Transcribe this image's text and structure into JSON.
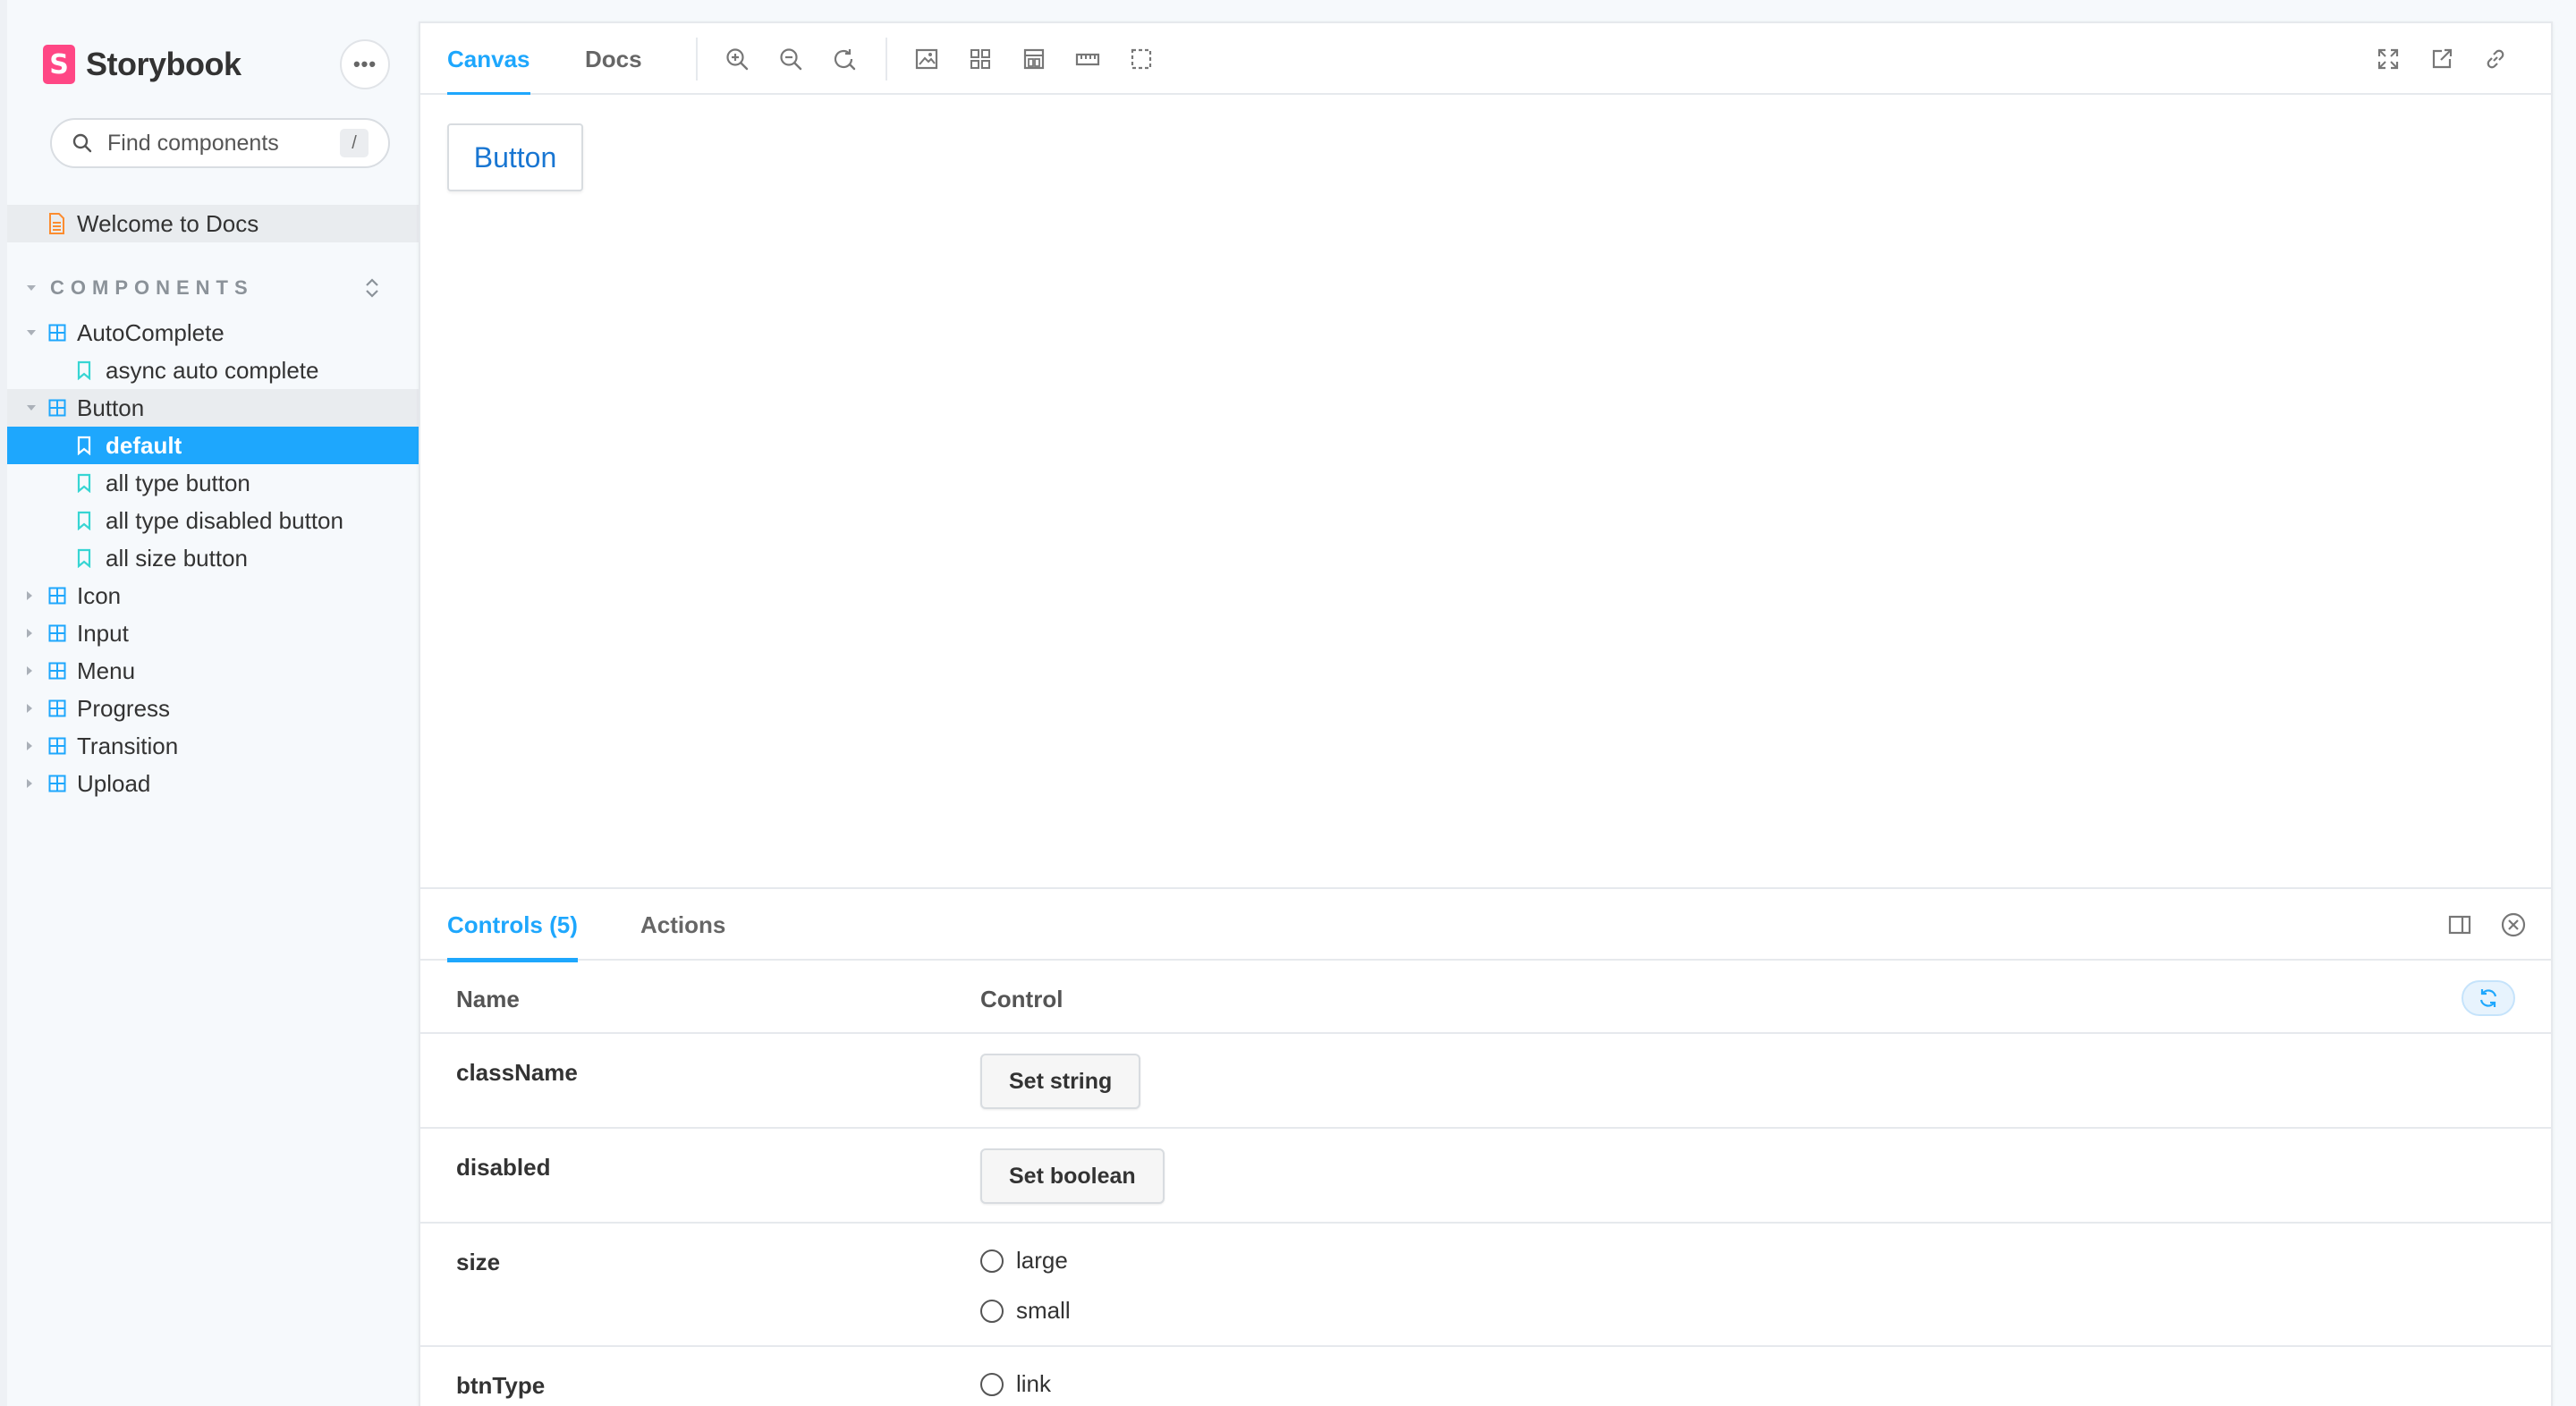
{
  "brand": {
    "logo_letter": "S",
    "name": "Storybook"
  },
  "menu": {
    "label": "•••"
  },
  "search": {
    "placeholder": "Find components",
    "shortcut": "/"
  },
  "sidebar": {
    "welcome": "Welcome to Docs",
    "section_title": "COMPONENTS",
    "items": [
      {
        "label": "AutoComplete"
      },
      {
        "label": "async auto complete"
      },
      {
        "label": "Button"
      },
      {
        "label": "default"
      },
      {
        "label": "all type button"
      },
      {
        "label": "all type disabled button"
      },
      {
        "label": "all size button"
      },
      {
        "label": "Icon"
      },
      {
        "label": "Input"
      },
      {
        "label": "Menu"
      },
      {
        "label": "Progress"
      },
      {
        "label": "Transition"
      },
      {
        "label": "Upload"
      }
    ]
  },
  "toolbar": {
    "tab_canvas": "Canvas",
    "tab_docs": "Docs"
  },
  "canvas": {
    "button_label": "Button"
  },
  "addons": {
    "tab_controls": "Controls (5)",
    "tab_actions": "Actions"
  },
  "controls": {
    "col_name": "Name",
    "col_control": "Control",
    "rows": [
      {
        "name": "className",
        "control": "Set string"
      },
      {
        "name": "disabled",
        "control": "Set boolean"
      },
      {
        "name": "size",
        "options": [
          "large",
          "small"
        ]
      },
      {
        "name": "btnType",
        "options": [
          "link"
        ]
      }
    ]
  },
  "colors": {
    "accent": "#1ea7fd",
    "brand": "#ff4785",
    "component_icon": "#1ea7fd",
    "story_icon": "#37d5d3",
    "doc_icon": "#fc8c2f"
  }
}
